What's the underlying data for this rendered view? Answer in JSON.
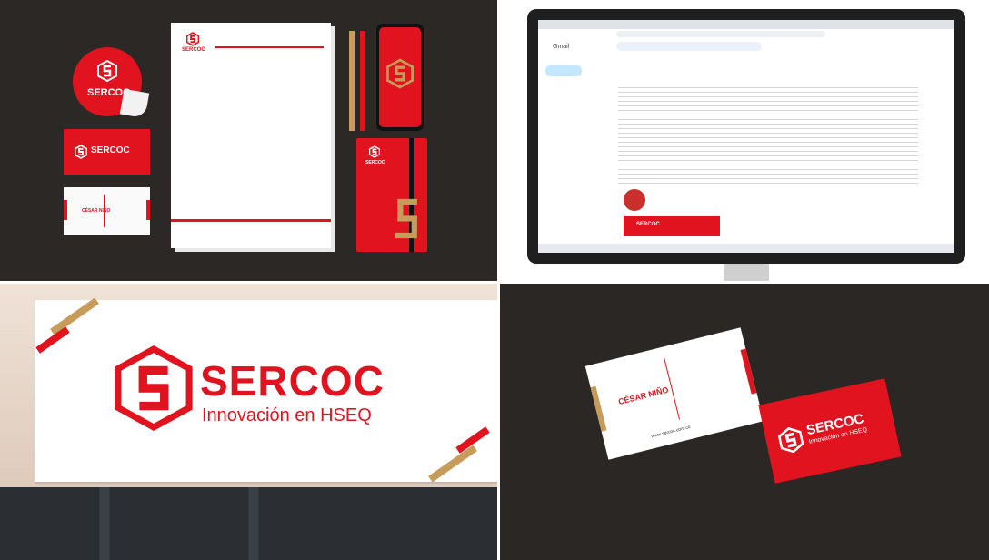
{
  "brand": {
    "name": "SERCOC",
    "tagline": "Innovación en HSEQ",
    "colors": {
      "primary": "#e0131f",
      "accent": "#c79b5a",
      "dark": "#2b2826"
    }
  },
  "stationery": {
    "sticker_text": "SERCOC",
    "red_card_name": "SERCOC",
    "white_card_name": "CÉSAR NIÑO",
    "notebook_name": "SERCOC",
    "letterhead_name": "SERCOC"
  },
  "sign": {
    "name": "SERCOC",
    "tagline": "Innovación en HSEQ"
  },
  "cards": {
    "person_name": "CÉSAR NIÑO",
    "website": "www.sercoc.com.co",
    "front_name": "SERCOC",
    "front_tagline": "Innovación en HSEQ"
  },
  "email": {
    "app_name": "Gmail"
  }
}
